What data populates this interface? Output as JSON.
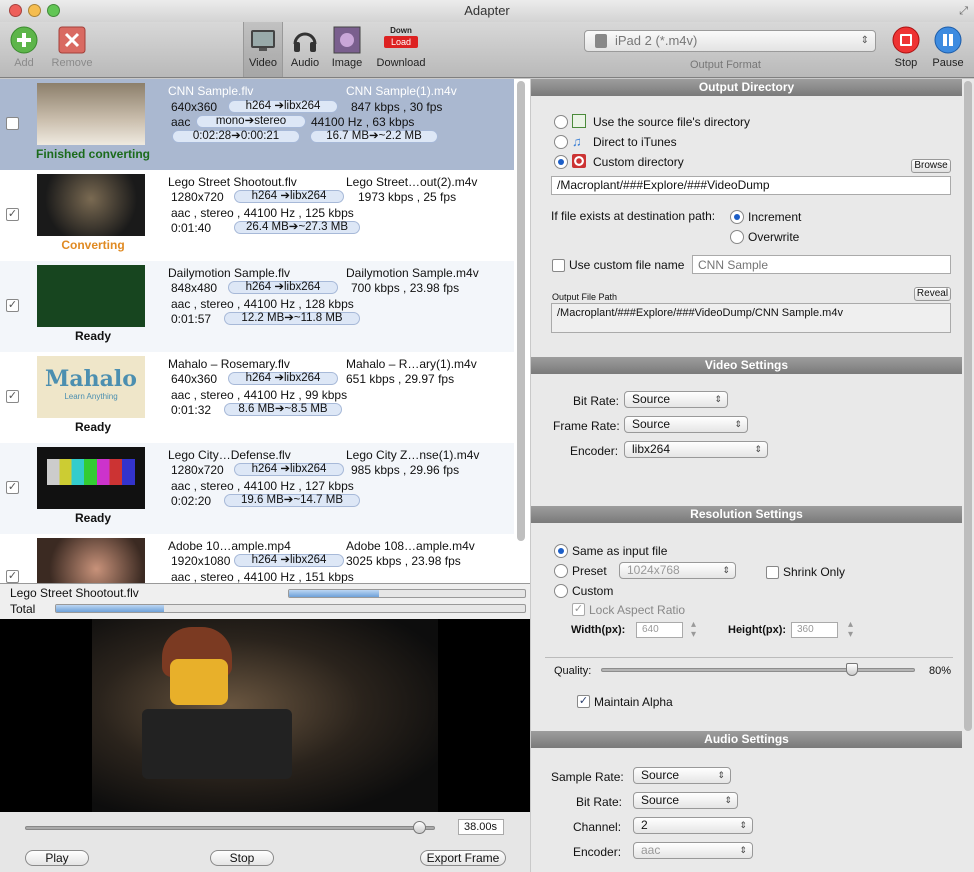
{
  "window": {
    "title": "Adapter"
  },
  "toolbar": {
    "add": "Add",
    "remove": "Remove",
    "video": "Video",
    "audio": "Audio",
    "image": "Image",
    "download": "Download",
    "download_icon_top": "Down",
    "download_icon_box": "Load",
    "output_format": "iPad 2 (*.m4v)",
    "output_format_label": "Output Format",
    "stop": "Stop",
    "pause": "Pause"
  },
  "files": [
    {
      "src": "CNN Sample.flv",
      "dst": "CNN Sample(1).m4v",
      "res": "640x360",
      "vcodec": "h264 ➔libx264",
      "vrate": "847 kbps , 30 fps",
      "acodec": "aac",
      "ach": "mono➔stereo",
      "arate": "44100 Hz , 63 kbps",
      "dur": "0:02:28➔0:00:21",
      "size": "16.7 MB➔~2.2 MB",
      "status": "Finished converting",
      "checked": false,
      "selected": true
    },
    {
      "src": "Lego Street Shootout.flv",
      "dst": "Lego Street…out(2).m4v",
      "res": "1280x720",
      "vcodec": "h264 ➔libx264",
      "vrate": "1973 kbps , 25 fps",
      "audio": "aac , stereo , 44100 Hz , 125 kbps",
      "dur": "0:01:40",
      "size": "26.4 MB➔~27.3 MB",
      "status": "Converting",
      "checked": true
    },
    {
      "src": "Dailymotion Sample.flv",
      "dst": "Dailymotion Sample.m4v",
      "res": "848x480",
      "vcodec": "h264 ➔libx264",
      "vrate": "700 kbps , 23.98 fps",
      "audio": "aac , stereo , 44100 Hz , 128 kbps",
      "dur": "0:01:57",
      "size": "12.2 MB➔~11.8 MB",
      "status": "Ready",
      "checked": true
    },
    {
      "src": "Mahalo – Rosemary.flv",
      "dst": "Mahalo – R…ary(1).m4v",
      "res": "640x360",
      "vcodec": "h264 ➔libx264",
      "vrate": "651 kbps , 29.97 fps",
      "audio": "aac , stereo , 44100 Hz , 99 kbps",
      "dur": "0:01:32",
      "size": "8.6 MB➔~8.5 MB",
      "status": "Ready",
      "checked": true,
      "thumb_title": "Mahalo",
      "thumb_sub": "Learn Anything"
    },
    {
      "src": "Lego City…Defense.flv",
      "dst": "Lego City Z…nse(1).m4v",
      "res": "1280x720",
      "vcodec": "h264 ➔libx264",
      "vrate": "985 kbps , 29.96 fps",
      "audio": "aac , stereo , 44100 Hz , 127 kbps",
      "dur": "0:02:20",
      "size": "19.6 MB➔~14.7 MB",
      "status": "Ready",
      "checked": true
    },
    {
      "src": "Adobe 10…ample.mp4",
      "dst": "Adobe 108…ample.m4v",
      "res": "1920x1080",
      "vcodec": "h264 ➔libx264",
      "vrate": "3025 kbps , 23.98 fps",
      "audio": "aac , stereo , 44100 Hz , 151 kbps",
      "checked": true
    }
  ],
  "progress": {
    "current_file": "Lego Street Shootout.flv",
    "current": 0.38,
    "total_label": "Total",
    "total": 0.23
  },
  "player": {
    "position": 0.96,
    "time": "38.00s",
    "play": "Play",
    "stop": "Stop",
    "export": "Export Frame"
  },
  "output_dir": {
    "header": "Output Directory",
    "opt_source": "Use the source file's directory",
    "opt_itunes": "Direct to iTunes",
    "opt_custom": "Custom directory",
    "browse": "Browse",
    "path": "/Macroplant/###Explore/###VideoDump",
    "exists_label": "If file exists at destination path:",
    "increment": "Increment",
    "overwrite": "Overwrite",
    "custom_name_label": "Use custom file name",
    "custom_name_placeholder": "CNN Sample",
    "file_path_label": "Output File Path",
    "reveal": "Reveal",
    "file_path": "/Macroplant/###Explore/###VideoDump/CNN Sample.m4v"
  },
  "video": {
    "header": "Video Settings",
    "bitrate_label": "Bit Rate:",
    "bitrate": "Source",
    "framerate_label": "Frame Rate:",
    "framerate": "Source",
    "encoder_label": "Encoder:",
    "encoder": "libx264"
  },
  "resolution": {
    "header": "Resolution Settings",
    "same": "Same as input file",
    "preset": "Preset",
    "preset_value": "1024x768",
    "shrink": "Shrink Only",
    "custom": "Custom",
    "lock": "Lock Aspect Ratio",
    "width_label": "Width(px):",
    "width": "640",
    "height_label": "Height(px):",
    "height": "360"
  },
  "quality": {
    "label": "Quality:",
    "value": 0.8,
    "text": "80%",
    "alpha": "Maintain Alpha"
  },
  "audio": {
    "header": "Audio Settings",
    "samplerate_label": "Sample Rate:",
    "samplerate": "Source",
    "bitrate_label": "Bit Rate:",
    "bitrate": "Source",
    "channel_label": "Channel:",
    "channel": "2",
    "encoder_label": "Encoder:",
    "encoder": "aac"
  }
}
